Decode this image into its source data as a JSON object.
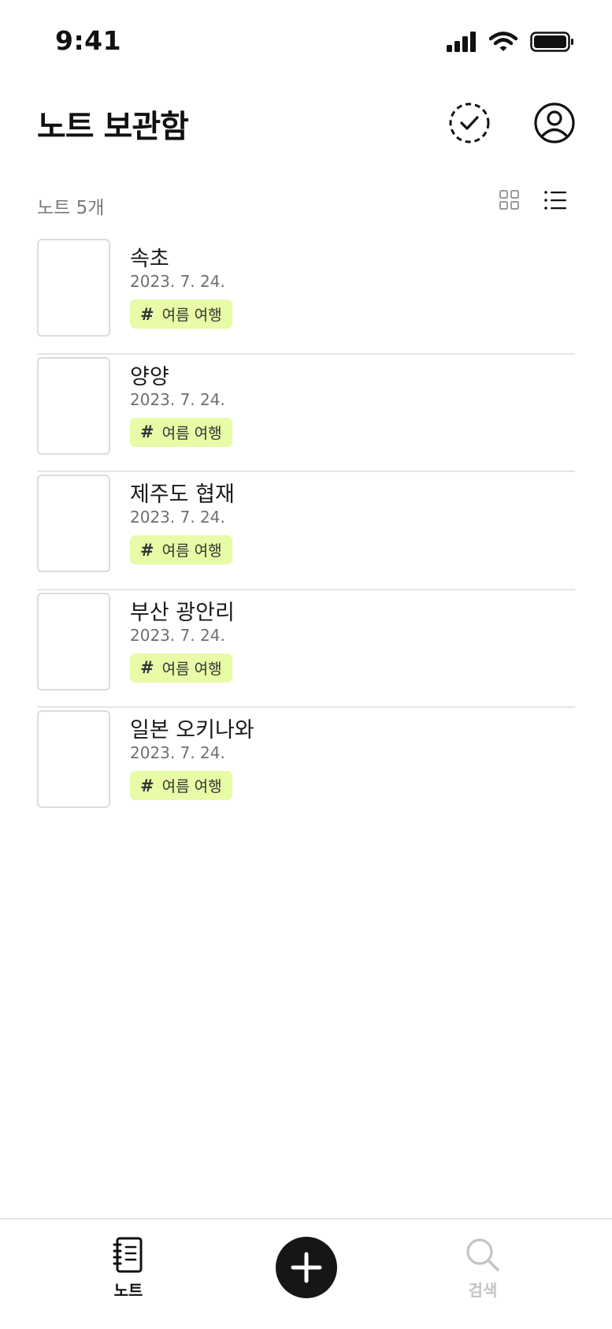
{
  "status_bar": {
    "time": "9:41"
  },
  "header": {
    "title": "노트 보관함"
  },
  "toolbar": {
    "note_count": "노트 5개"
  },
  "notes": [
    {
      "title": "속초",
      "date": "2023. 7. 24.",
      "tag": "여름 여행"
    },
    {
      "title": "양양",
      "date": "2023. 7. 24.",
      "tag": "여름 여행"
    },
    {
      "title": "제주도 협재",
      "date": "2023. 7. 24.",
      "tag": "여름 여행"
    },
    {
      "title": "부산 광안리",
      "date": "2023. 7. 24.",
      "tag": "여름 여행"
    },
    {
      "title": "일본 오키나와",
      "date": "2023. 7. 24.",
      "tag": "여름 여행"
    }
  ],
  "tag_symbol": "#",
  "tab_bar": {
    "notes_label": "노트",
    "search_label": "검색"
  },
  "colors": {
    "tag_background": "#e8fba6",
    "active_tab": "#111111",
    "inactive_tab": "#c4c4c4",
    "add_button": "#161616"
  },
  "icons": {
    "header": [
      "select-check-icon",
      "profile-icon"
    ],
    "toolbar": [
      "grid-view-icon",
      "list-view-icon"
    ],
    "tabs": [
      "notebook-icon",
      "plus-icon",
      "search-icon"
    ]
  }
}
